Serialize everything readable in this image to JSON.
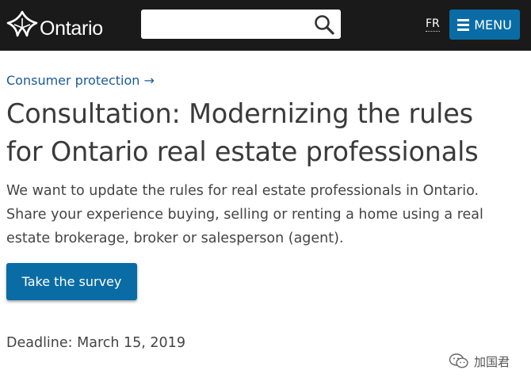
{
  "header": {
    "logo_text": "Ontario",
    "search": {
      "placeholder": "",
      "value": ""
    },
    "lang_label": "FR",
    "menu_label": "MENU"
  },
  "breadcrumb": {
    "label": "Consumer protection →"
  },
  "page": {
    "title": "Consultation: Modernizing the rules for Ontario real estate professionals",
    "lead": "We want to update the rules for real estate professionals in Ontario. Share your experience buying, selling or renting a home using a real estate brokerage, broker or salesperson (agent).",
    "cta_label": "Take the survey",
    "deadline": "Deadline: March 15, 2019"
  },
  "watermark": {
    "label": "加国君"
  },
  "colors": {
    "header_bg": "#1a1a1a",
    "accent": "#0a6ca5",
    "link": "#1a5a96",
    "text": "#3a3a3a"
  },
  "icons": [
    "trillium-logo-icon",
    "search-icon",
    "menu-icon",
    "wechat-icon"
  ]
}
